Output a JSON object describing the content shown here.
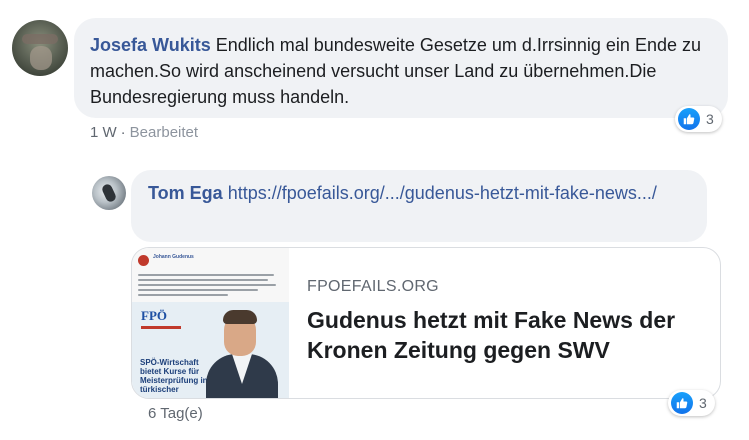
{
  "comment1": {
    "author": "Josefa Wukits",
    "text": "Endlich mal bundesweite Gesetze um d.Irrsinnig ein Ende zu machen.So wird anscheinend versucht unser Land zu übernehmen.Die Bundesregierung muss handeln.",
    "time": "1 W",
    "edited": "Bearbeitet",
    "reactions": {
      "icon": "like-icon",
      "count": "3"
    }
  },
  "reply": {
    "author": "Tom Ega",
    "link_text": "https://fpoefails.org/.../gudenus-hetzt-mit-fake-news.../",
    "preview": {
      "domain": "FPOEFAILS.ORG",
      "title": "Gudenus hetzt mit Fake News der Kronen Zeitung gegen SWV",
      "thumb": {
        "page_name": "Johann Gudenus",
        "logo": "FPÖ",
        "poster_text": "SPÖ-Wirtschaft bietet Kurse für Meisterprüfung in türkischer"
      }
    },
    "time": "6 Tag(e)",
    "reactions": {
      "icon": "like-icon",
      "count": "3"
    }
  },
  "colors": {
    "name_link": "#385898",
    "bubble": "#f0f2f5",
    "like": "#1877f2"
  }
}
